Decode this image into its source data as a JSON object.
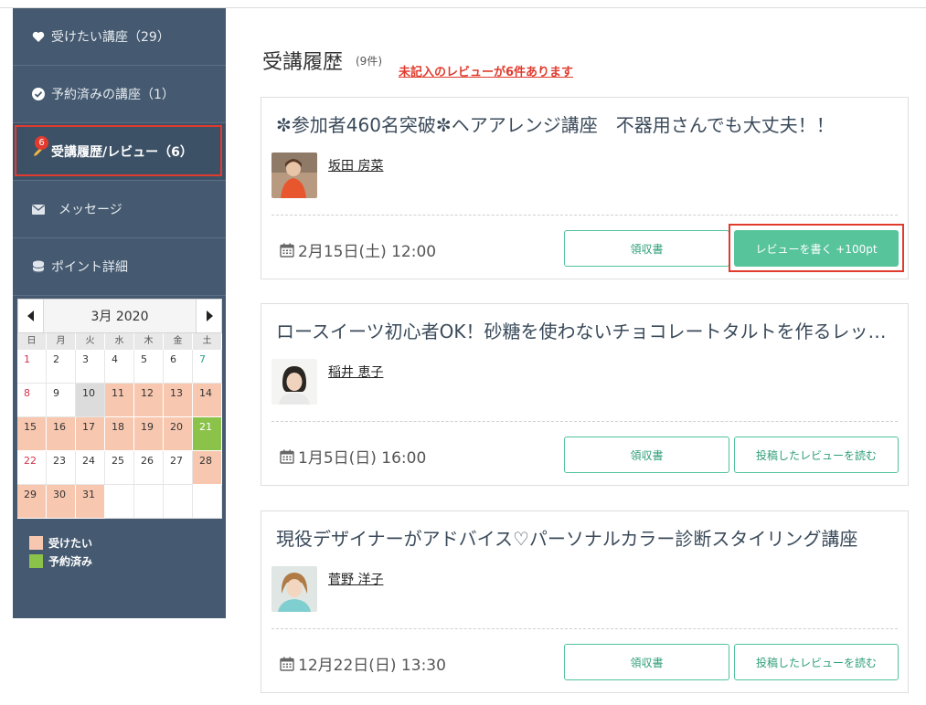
{
  "sidebar": {
    "items": [
      {
        "label": "受けたい講座（29）",
        "icon": "heart-icon"
      },
      {
        "label": "予約済みの講座（1）",
        "icon": "check-circle-icon"
      },
      {
        "label": "受講履歴/レビュー（6）",
        "icon": "pencil-icon",
        "badge": "6"
      },
      {
        "label": "メッセージ",
        "icon": "envelope-icon"
      },
      {
        "label": "ポイント詳細",
        "icon": "coins-icon"
      }
    ]
  },
  "calendar": {
    "title": "3月 2020",
    "weekdays": [
      "日",
      "月",
      "火",
      "水",
      "木",
      "金",
      "土"
    ],
    "days": [
      {
        "d": "1"
      },
      {
        "d": "2"
      },
      {
        "d": "3"
      },
      {
        "d": "4"
      },
      {
        "d": "5"
      },
      {
        "d": "6"
      },
      {
        "d": "7"
      },
      {
        "d": "8"
      },
      {
        "d": "9"
      },
      {
        "d": "10"
      },
      {
        "d": "11"
      },
      {
        "d": "12"
      },
      {
        "d": "13"
      },
      {
        "d": "14"
      },
      {
        "d": "15"
      },
      {
        "d": "16"
      },
      {
        "d": "17"
      },
      {
        "d": "18"
      },
      {
        "d": "19"
      },
      {
        "d": "20"
      },
      {
        "d": "21"
      },
      {
        "d": "22"
      },
      {
        "d": "23"
      },
      {
        "d": "24"
      },
      {
        "d": "25"
      },
      {
        "d": "26"
      },
      {
        "d": "27"
      },
      {
        "d": "28"
      },
      {
        "d": "29"
      },
      {
        "d": "30"
      },
      {
        "d": "31"
      },
      {
        "d": ""
      },
      {
        "d": ""
      },
      {
        "d": ""
      },
      {
        "d": ""
      }
    ],
    "legend": [
      {
        "label": "受けたい",
        "color": "#f8c7b0"
      },
      {
        "label": "予約済み",
        "color": "#8bc34a"
      }
    ]
  },
  "main": {
    "title": "受講履歴",
    "count": "(9件)",
    "warning": "未記入のレビューが6件あります",
    "courses": [
      {
        "title": "✼参加者460名突破✼ヘアアレンジ講座　不器用さんでも大丈夫！！",
        "teacher": "坂田 房菜",
        "date": "2月15日(土) 12:00",
        "receipt_label": "領収書",
        "action_label": "レビューを書く +100pt"
      },
      {
        "title": "ロースイーツ初心者OK！砂糖を使わないチョコレートタルトを作るレッスン",
        "teacher": "稲井 恵子",
        "date": "1月5日(日) 16:00",
        "receipt_label": "領収書",
        "action_label": "投稿したレビューを読む"
      },
      {
        "title": "現役デザイナーがアドバイス♡パーソナルカラー診断スタイリング講座",
        "teacher": "菅野 洋子",
        "date": "12月22日(日) 13:30",
        "receipt_label": "領収書",
        "action_label": "投稿したレビューを読む"
      }
    ]
  }
}
